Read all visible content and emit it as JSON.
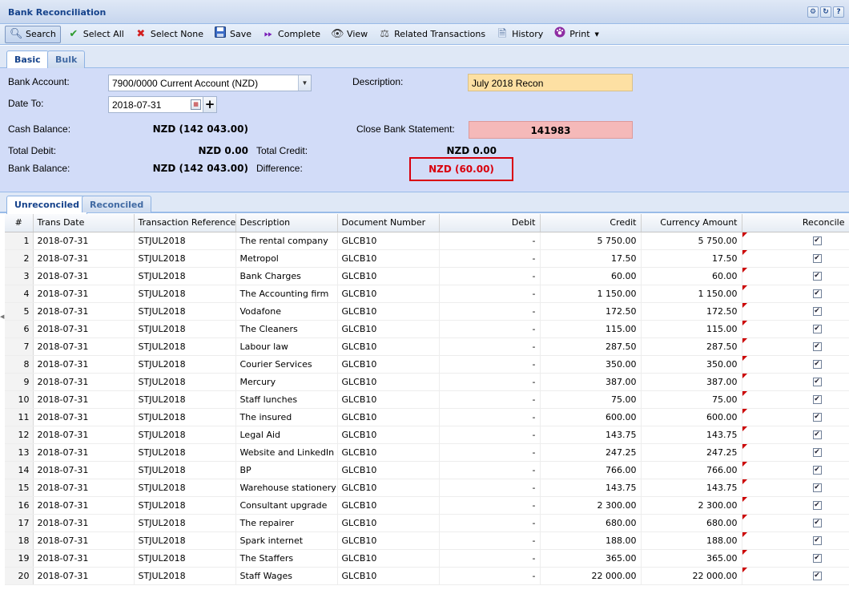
{
  "window": {
    "title": "Bank Reconciliation",
    "tools": [
      "gear-icon",
      "refresh-icon",
      "help-icon"
    ]
  },
  "toolbar": {
    "search": "Search",
    "select_all": "Select All",
    "select_none": "Select None",
    "save": "Save",
    "complete": "Complete",
    "view": "View",
    "related": "Related Transactions",
    "history": "History",
    "print": "Print"
  },
  "form_tabs": {
    "basic": "Basic",
    "bulk": "Bulk"
  },
  "form": {
    "bank_account_label": "Bank Account:",
    "bank_account_value": "7900/0000 Current Account (NZD)",
    "date_to_label": "Date To:",
    "date_to_value": "2018-07-31",
    "description_label": "Description:",
    "description_value": "July 2018 Recon",
    "cash_balance_label": "Cash Balance:",
    "cash_balance_value": "NZD (142 043.00)",
    "close_statement_label": "Close Bank Statement:",
    "close_statement_value": "141983",
    "total_debit_label": "Total Debit:",
    "total_debit_value": "NZD 0.00",
    "total_credit_label": "Total Credit:",
    "total_credit_value": "NZD 0.00",
    "bank_balance_label": "Bank Balance:",
    "bank_balance_value": "NZD (142 043.00)",
    "difference_label": "Difference:",
    "difference_value": "NZD (60.00)"
  },
  "grid_tabs": {
    "unreconciled": "Unreconciled",
    "reconciled": "Reconciled"
  },
  "grid": {
    "columns": [
      "#",
      "Trans Date",
      "Transaction Reference",
      "Description",
      "Document Number",
      "Debit",
      "Credit",
      "Currency Amount",
      "Reconcile"
    ],
    "rows": [
      {
        "n": "1",
        "date": "2018-07-31",
        "ref": "STJUL2018",
        "desc": "The rental company",
        "doc": "GLCB10",
        "debit": "-",
        "credit": "5 750.00",
        "amount": "5 750.00",
        "checked": true
      },
      {
        "n": "2",
        "date": "2018-07-31",
        "ref": "STJUL2018",
        "desc": "Metropol",
        "doc": "GLCB10",
        "debit": "-",
        "credit": "17.50",
        "amount": "17.50",
        "checked": true
      },
      {
        "n": "3",
        "date": "2018-07-31",
        "ref": "STJUL2018",
        "desc": "Bank Charges",
        "doc": "GLCB10",
        "debit": "-",
        "credit": "60.00",
        "amount": "60.00",
        "checked": true
      },
      {
        "n": "4",
        "date": "2018-07-31",
        "ref": "STJUL2018",
        "desc": "The Accounting firm",
        "doc": "GLCB10",
        "debit": "-",
        "credit": "1 150.00",
        "amount": "1 150.00",
        "checked": true
      },
      {
        "n": "5",
        "date": "2018-07-31",
        "ref": "STJUL2018",
        "desc": "Vodafone",
        "doc": "GLCB10",
        "debit": "-",
        "credit": "172.50",
        "amount": "172.50",
        "checked": true
      },
      {
        "n": "6",
        "date": "2018-07-31",
        "ref": "STJUL2018",
        "desc": "The Cleaners",
        "doc": "GLCB10",
        "debit": "-",
        "credit": "115.00",
        "amount": "115.00",
        "checked": true
      },
      {
        "n": "7",
        "date": "2018-07-31",
        "ref": "STJUL2018",
        "desc": "Labour law",
        "doc": "GLCB10",
        "debit": "-",
        "credit": "287.50",
        "amount": "287.50",
        "checked": true
      },
      {
        "n": "8",
        "date": "2018-07-31",
        "ref": "STJUL2018",
        "desc": "Courier Services",
        "doc": "GLCB10",
        "debit": "-",
        "credit": "350.00",
        "amount": "350.00",
        "checked": true
      },
      {
        "n": "9",
        "date": "2018-07-31",
        "ref": "STJUL2018",
        "desc": "Mercury",
        "doc": "GLCB10",
        "debit": "-",
        "credit": "387.00",
        "amount": "387.00",
        "checked": true
      },
      {
        "n": "10",
        "date": "2018-07-31",
        "ref": "STJUL2018",
        "desc": "Staff lunches",
        "doc": "GLCB10",
        "debit": "-",
        "credit": "75.00",
        "amount": "75.00",
        "checked": true
      },
      {
        "n": "11",
        "date": "2018-07-31",
        "ref": "STJUL2018",
        "desc": "The insured",
        "doc": "GLCB10",
        "debit": "-",
        "credit": "600.00",
        "amount": "600.00",
        "checked": true
      },
      {
        "n": "12",
        "date": "2018-07-31",
        "ref": "STJUL2018",
        "desc": "Legal Aid",
        "doc": "GLCB10",
        "debit": "-",
        "credit": "143.75",
        "amount": "143.75",
        "checked": true
      },
      {
        "n": "13",
        "date": "2018-07-31",
        "ref": "STJUL2018",
        "desc": "Website and LinkedIn",
        "doc": "GLCB10",
        "debit": "-",
        "credit": "247.25",
        "amount": "247.25",
        "checked": true
      },
      {
        "n": "14",
        "date": "2018-07-31",
        "ref": "STJUL2018",
        "desc": "BP",
        "doc": "GLCB10",
        "debit": "-",
        "credit": "766.00",
        "amount": "766.00",
        "checked": true
      },
      {
        "n": "15",
        "date": "2018-07-31",
        "ref": "STJUL2018",
        "desc": "Warehouse stationery",
        "doc": "GLCB10",
        "debit": "-",
        "credit": "143.75",
        "amount": "143.75",
        "checked": true
      },
      {
        "n": "16",
        "date": "2018-07-31",
        "ref": "STJUL2018",
        "desc": "Consultant upgrade",
        "doc": "GLCB10",
        "debit": "-",
        "credit": "2 300.00",
        "amount": "2 300.00",
        "checked": true
      },
      {
        "n": "17",
        "date": "2018-07-31",
        "ref": "STJUL2018",
        "desc": "The repairer",
        "doc": "GLCB10",
        "debit": "-",
        "credit": "680.00",
        "amount": "680.00",
        "checked": true
      },
      {
        "n": "18",
        "date": "2018-07-31",
        "ref": "STJUL2018",
        "desc": "Spark internet",
        "doc": "GLCB10",
        "debit": "-",
        "credit": "188.00",
        "amount": "188.00",
        "checked": true
      },
      {
        "n": "19",
        "date": "2018-07-31",
        "ref": "STJUL2018",
        "desc": "The Staffers",
        "doc": "GLCB10",
        "debit": "-",
        "credit": "365.00",
        "amount": "365.00",
        "checked": true
      },
      {
        "n": "20",
        "date": "2018-07-31",
        "ref": "STJUL2018",
        "desc": "Staff Wages",
        "doc": "GLCB10",
        "debit": "-",
        "credit": "22 000.00",
        "amount": "22 000.00",
        "checked": true
      }
    ]
  },
  "colors": {
    "header_text": "#15428b",
    "form_bg": "#d2dcf8",
    "difference": "#d9000d",
    "description_bg": "#fde0a3",
    "close_statement_bg": "#f5b9b9"
  }
}
